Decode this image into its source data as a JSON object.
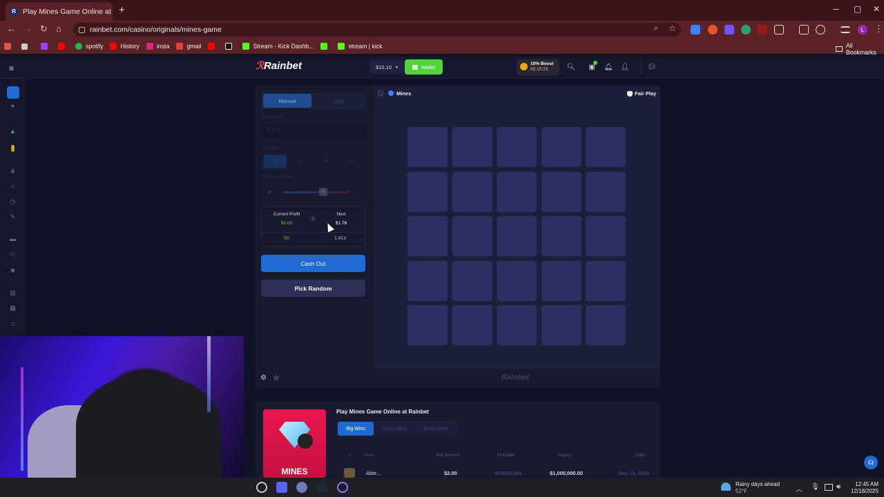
{
  "browser": {
    "tab_title": "Play Mines Game Online at Ra",
    "tab_favicon": "R",
    "url": "rainbet.com/casino/originals/mines-game",
    "bookmarks": [
      {
        "label": "",
        "icon": "twitch-icon",
        "color": "#9146ff"
      },
      {
        "label": "",
        "icon": "youtube-icon",
        "color": "#ff0000"
      },
      {
        "label": "spotify",
        "icon": "spotify-icon",
        "color": "#1db954"
      },
      {
        "label": "History",
        "icon": "youtube-icon",
        "color": "#ff0000"
      },
      {
        "label": "insta",
        "icon": "instagram-icon",
        "color": "#d62976"
      },
      {
        "label": "gmail",
        "icon": "gmail-icon",
        "color": "#ea4335"
      },
      {
        "label": "",
        "icon": "youtube-icon",
        "color": "#ff0000"
      },
      {
        "label": "",
        "icon": "x-icon",
        "color": "#000000"
      },
      {
        "label": "Stream - Kick Dashb...",
        "icon": "kick-icon",
        "color": "#53fc18"
      },
      {
        "label": "",
        "icon": "kick-icon",
        "color": "#53fc18"
      },
      {
        "label": "stream | kick",
        "icon": "kick-icon",
        "color": "#53fc18"
      }
    ],
    "all_bookmarks": "All Bookmarks"
  },
  "site": {
    "logo": "Rainbet",
    "balance": "$10.10",
    "wallet_label": "Wallet",
    "boost_title": "10% Boost",
    "boost_timer": "00:15:23"
  },
  "panel": {
    "tab_manual": "Manual",
    "tab_auto": "Auto",
    "bet_amount_label": "Bet Amount",
    "bet_amount_value": "1.25",
    "grid_size_label": "Grid Size",
    "grid_options": [
      "25",
      "36",
      "49",
      "64"
    ],
    "mines_label": "Number of Mines",
    "mines_value": "20",
    "current_profit_label": "Current Profit",
    "current_profit_value": "$0.00",
    "current_multiplier": "0x",
    "next_label": "Next",
    "next_value": "$1.76",
    "next_multiplier": "1.41x",
    "cash_out": "Cash Out",
    "pick_random": "Pick Random"
  },
  "game": {
    "title": "Mines",
    "fair_play": "Fair Play",
    "watermark": "Rainbet",
    "grid_rows": 5,
    "grid_cols": 5
  },
  "info": {
    "page_title": "Play Mines Game Online at Rainbet",
    "thumb_label": "MINES",
    "tabs": [
      "Big Wins",
      "Lucky Wins",
      "Description"
    ],
    "columns": [
      "#",
      "User",
      "Bet Amount",
      "Multiplier",
      "Payout",
      "Date"
    ],
    "row": {
      "user": "Able...",
      "bet": "$2.00",
      "multiplier": "500000.00x",
      "payout": "$1,000,000.00",
      "date": "May 13, 2025"
    }
  },
  "taskbar": {
    "weather_title": "Rainy days ahead",
    "weather_temp": "52°F",
    "time": "12:45 AM",
    "date": "12/18/2025"
  }
}
